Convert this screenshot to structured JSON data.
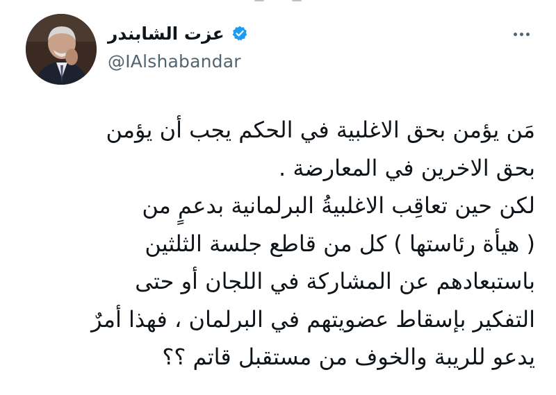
{
  "user": {
    "display_name": "عزت الشابندر",
    "handle": "@IAlshabandar",
    "verified": true
  },
  "icons": {
    "verified": "verified-badge-icon",
    "more": "more-dots-icon"
  },
  "colors": {
    "verified_badge": "#1d9bf0",
    "handle_text": "#536471",
    "body_text": "#0f1419"
  },
  "tweet": {
    "lines": [
      "مَن يؤمن بحق الاغلبية في الحكم يجب أن يؤمن",
      "بحق الاخرين في المعارضة .",
      "لكن حين تعاقِب الاغلبيةُ البرلمانية بدعمٍ من",
      "( هيأة رئاستها ) كل من قاطع جلسة الثلثين",
      "باستبعادهم عن المشاركة في اللجان أو حتى",
      "التفكير بإسقاط عضويتهم في البرلمان ، فهذا أمرٌ",
      "يدعو للريبة والخوف من مستقبل قاتم ؟؟"
    ]
  }
}
